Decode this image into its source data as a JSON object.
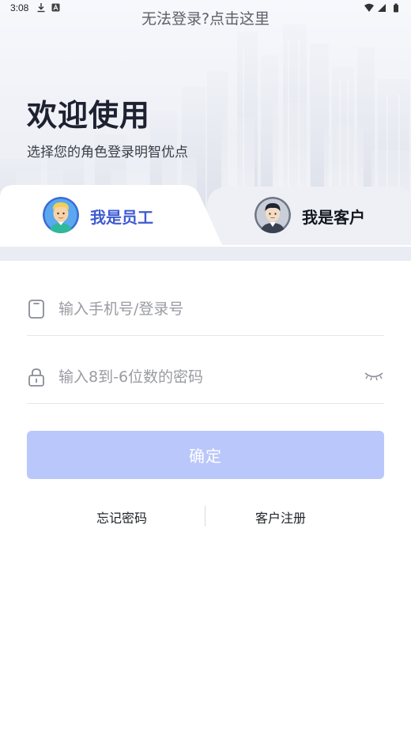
{
  "status_bar": {
    "time": "3:08",
    "icons": [
      "download-icon",
      "a-icon",
      "wifi-icon",
      "signal-icon",
      "battery-icon"
    ]
  },
  "header": {
    "help_link": "无法登录?点击这里",
    "title": "欢迎使用",
    "subtitle": "选择您的角色登录明智优点"
  },
  "tabs": {
    "staff": {
      "label": "我是员工",
      "active": true
    },
    "client": {
      "label": "我是客户",
      "active": false
    }
  },
  "form": {
    "phone_placeholder": "输入手机号/登录号",
    "phone_value": "",
    "password_placeholder": "输入8到-6位数的密码",
    "password_value": "",
    "confirm_label": "确定"
  },
  "footer_links": {
    "forgot": "忘记密码",
    "register": "客户注册"
  },
  "colors": {
    "accent": "#3d5bd1",
    "button_disabled": "#bac7fb",
    "divider": "#e6e7ec"
  }
}
